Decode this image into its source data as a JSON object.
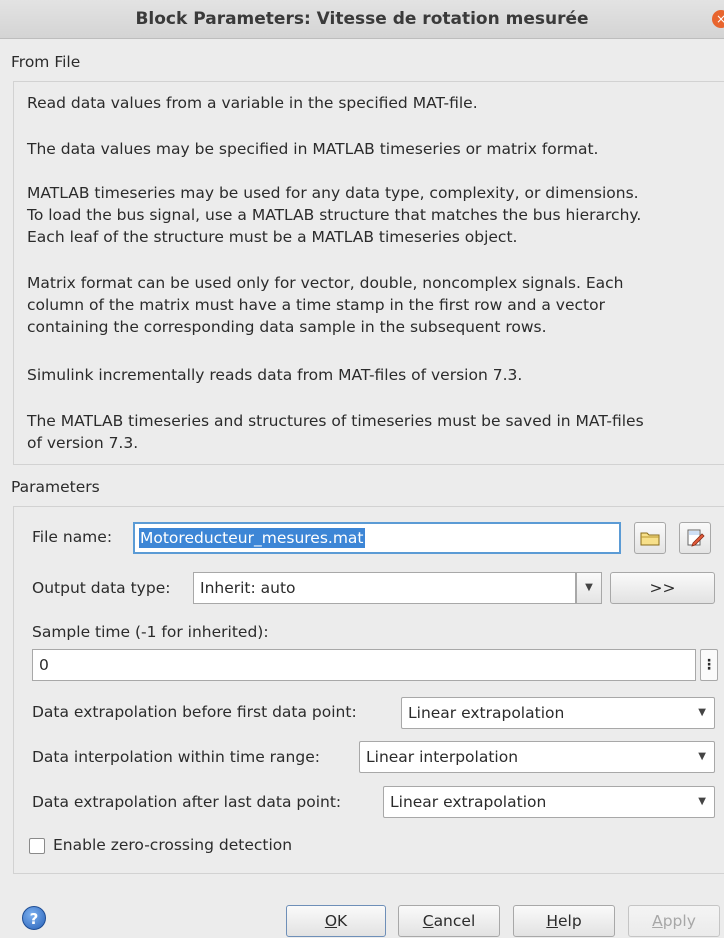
{
  "window": {
    "title": "Block Parameters: Vitesse de rotation mesurée",
    "close_glyph": "×"
  },
  "block_type": "From File",
  "description": [
    "Read data values from a variable in the specified MAT-file.",
    "The data values may be specified in MATLAB timeseries or matrix format.",
    "MATLAB timeseries may be used for any data type, complexity, or dimensions.\nTo load the bus signal, use a MATLAB structure that matches the bus hierarchy.\nEach leaf of the structure must be a MATLAB timeseries object.",
    "Matrix format can be used only for vector, double, noncomplex  signals. Each\ncolumn of the matrix must have a time stamp in the first row and a vector\ncontaining the corresponding data sample in the subsequent rows.",
    "Simulink incrementally reads data from MAT-files of version 7.3.",
    "The MATLAB timeseries and structures of timeseries must be saved in MAT-files\nof version 7.3."
  ],
  "parameters_label": "Parameters",
  "params": {
    "file_name_label": "File name:",
    "file_name_value": "Motoreducteur_mesures.mat",
    "output_type_label": "Output data type:",
    "output_type_value": "Inherit: auto",
    "output_type_arrow": "▼",
    "show_assistant_label": ">>",
    "sample_time_label": "Sample time (-1 for inherited):",
    "sample_time_value": "0",
    "more_glyph": "⋮",
    "extrap_before_label": "Data extrapolation before first data point:",
    "extrap_before_value": "Linear extrapolation",
    "interp_label": "Data interpolation within time range:",
    "interp_value": "Linear interpolation",
    "extrap_after_label": "Data extrapolation after last data point:",
    "extrap_after_value": "Linear extrapolation",
    "dropdown_arrow": "▼",
    "zero_crossing_label": "Enable zero-crossing detection",
    "zero_crossing_checked": false
  },
  "buttons": {
    "help_glyph": "?",
    "ok_mnemonic": "O",
    "ok_rest": "K",
    "cancel_mnemonic": "C",
    "cancel_rest": "ancel",
    "help_mnemonic": "H",
    "help_rest": "elp",
    "apply_mnemonic": "A",
    "apply_rest": "pply"
  },
  "icons": {
    "browse": "folder-icon",
    "edit": "edit-file-icon",
    "help": "help-icon"
  }
}
